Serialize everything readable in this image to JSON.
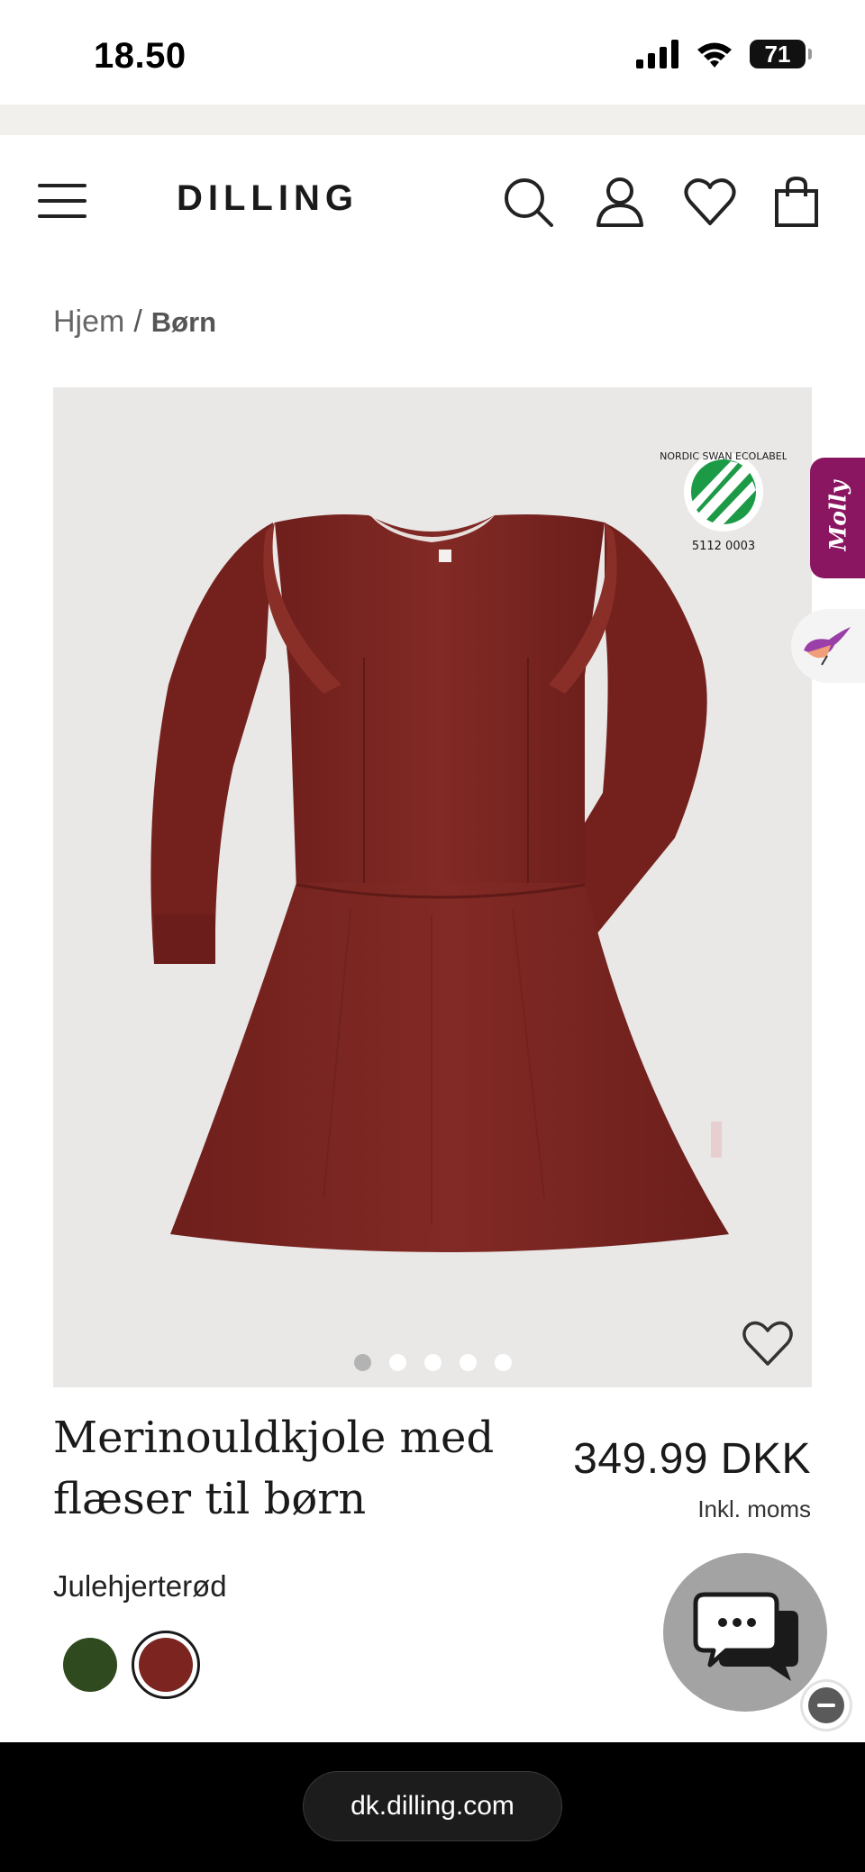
{
  "status_bar": {
    "time": "18.50",
    "battery": "71"
  },
  "header": {
    "logo": "DILLING",
    "icons": [
      "menu-icon",
      "search-icon",
      "user-icon",
      "heart-icon",
      "bag-icon"
    ]
  },
  "breadcrumb": {
    "home": "Hjem",
    "separator": "/",
    "current": "Børn"
  },
  "gallery": {
    "ecolabel_top": "NORDIC SWAN ECOLABEL",
    "ecolabel_code": "5112 0003",
    "slide_count": 5,
    "active_slide": 1,
    "dress_color": "#7b2420"
  },
  "side_widgets": {
    "molly_label": "Molly"
  },
  "product": {
    "title_line1": "Merinouldkjole med",
    "title_line2": "flæser til børn",
    "price": "349.99 DKK",
    "vat_note": "Inkl. moms",
    "color_name": "Julehjerterød",
    "swatches": [
      {
        "color": "#2f4a1f",
        "selected": false
      },
      {
        "color": "#7b2420",
        "selected": true
      }
    ]
  },
  "browser": {
    "url": "dk.dilling.com"
  }
}
